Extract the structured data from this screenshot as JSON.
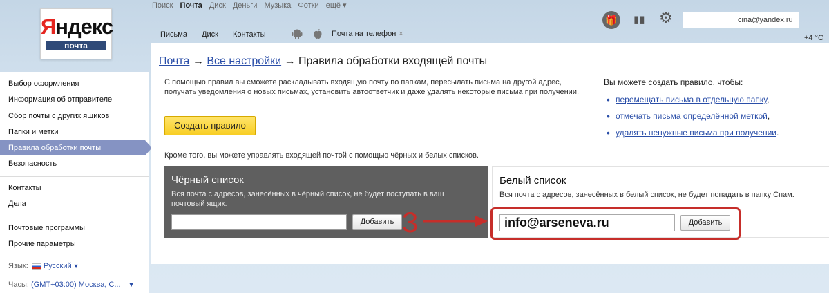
{
  "header": {
    "logo": {
      "brand_red": "Я",
      "brand_black": "ндекс",
      "subtitle": "почта"
    },
    "services": [
      "Поиск",
      "Почта",
      "Диск",
      "Деньги",
      "Музыка",
      "Фотки",
      "ещё ▾"
    ],
    "services_active_index": 1,
    "mail_nav": [
      "Письма",
      "Диск",
      "Контакты"
    ],
    "phone_tab": "Почта на телефон",
    "phone_tab_close": "×",
    "user_email": "cina@yandex.ru",
    "weather": "+4 °C",
    "icons": [
      "gift-icon",
      "books-icon",
      "gear-icon",
      "android-icon",
      "apple-icon"
    ]
  },
  "sidebar": {
    "group1": [
      "Выбор оформления",
      "Информация об отправителе",
      "Сбор почты с других ящиков",
      "Папки и метки",
      "Правила обработки почты",
      "Безопасность"
    ],
    "active_item": "Правила обработки почты",
    "group2": [
      "Контакты",
      "Дела"
    ],
    "group3": [
      "Почтовые программы",
      "Прочие параметры"
    ],
    "language_label": "Язык:",
    "language_value": "Русский",
    "timezone_label": "Часы:",
    "timezone_value": "(GMT+03:00) Москва, С..."
  },
  "main": {
    "breadcrumb": {
      "link1": "Почта",
      "sep1": " → ",
      "link2": "Все настройки",
      "sep2": " → ",
      "current": "Правила обработки входящей почты"
    },
    "intro_text": "С помощью правил вы сможете раскладывать входящую почту по папкам, пересылать письма на другой адрес, получать уведомления о новых письмах, установить автоответчик и даже удалять некоторые письма при получении.",
    "create_button": "Создать правило",
    "rules_heading": "Вы можете создать правило, чтобы:",
    "rules_links": [
      "перемещать письма в отдельную папку",
      "отмечать письма определённой меткой",
      "удалять ненужные письма при получении"
    ],
    "lists_note": "Кроме того, вы можете управлять входящей почтой с помощью чёрных и белых списков.",
    "blacklist": {
      "title": "Чёрный список",
      "description": "Вся почта с адресов, занесённых в чёрный список, не будет поступать в ваш почтовый ящик.",
      "input_value": "",
      "button": "Добавить"
    },
    "whitelist": {
      "title": "Белый список",
      "description": "Вся почта с адресов, занесённых в белый список, не будет попадать в папку Спам.",
      "input_value": "info@arseneva.ru",
      "button": "Добавить"
    },
    "annotation": {
      "label": "3",
      "color": "#c62e2a"
    }
  }
}
